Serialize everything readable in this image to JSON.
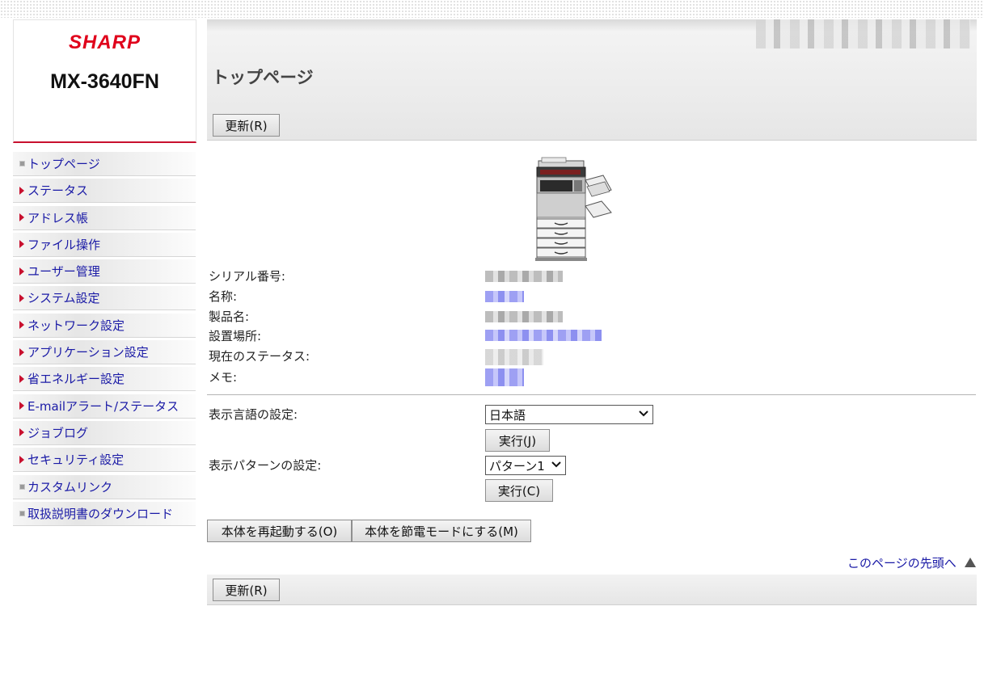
{
  "brand": {
    "logo_text": "SHARP",
    "model": "MX-3640FN"
  },
  "sidebar": {
    "items": [
      {
        "label": "トップページ",
        "icon": "square-bullet-icon"
      },
      {
        "label": "ステータス",
        "icon": "triangle-right-icon"
      },
      {
        "label": "アドレス帳",
        "icon": "triangle-right-icon"
      },
      {
        "label": "ファイル操作",
        "icon": "triangle-right-icon"
      },
      {
        "label": "ユーザー管理",
        "icon": "triangle-right-icon"
      },
      {
        "label": "システム設定",
        "icon": "triangle-right-icon"
      },
      {
        "label": "ネットワーク設定",
        "icon": "triangle-right-icon"
      },
      {
        "label": "アプリケーション設定",
        "icon": "triangle-right-icon"
      },
      {
        "label": "省エネルギー設定",
        "icon": "triangle-right-icon"
      },
      {
        "label": "E-mailアラート/ステータス",
        "icon": "triangle-right-icon"
      },
      {
        "label": "ジョブログ",
        "icon": "triangle-right-icon"
      },
      {
        "label": "セキュリティ設定",
        "icon": "triangle-right-icon"
      },
      {
        "label": "カスタムリンク",
        "icon": "square-bullet-icon"
      },
      {
        "label": "取扱説明書のダウンロード",
        "icon": "square-bullet-icon"
      }
    ]
  },
  "header": {
    "title": "トップページ",
    "refresh_label": "更新(R)"
  },
  "info": {
    "serial_label": "シリアル番号:",
    "name_label": "名称:",
    "product_label": "製品名:",
    "location_label": "設置場所:",
    "status_label": "現在のステータス:",
    "memo_label": "メモ:"
  },
  "settings": {
    "language_label": "表示言語の設定:",
    "language_value": "日本語",
    "language_execute": "実行(J)",
    "pattern_label": "表示パターンの設定:",
    "pattern_value": "パターン1",
    "pattern_execute": "実行(C)"
  },
  "actions": {
    "restart": "本体を再起動する(O)",
    "power_save": "本体を節電モードにする(M)"
  },
  "footer": {
    "top_link": "このページの先頭へ",
    "refresh_label": "更新(R)"
  },
  "colors": {
    "brand_red": "#e0001b",
    "link_blue": "#1a1aa6",
    "accent_red": "#c8102e"
  }
}
